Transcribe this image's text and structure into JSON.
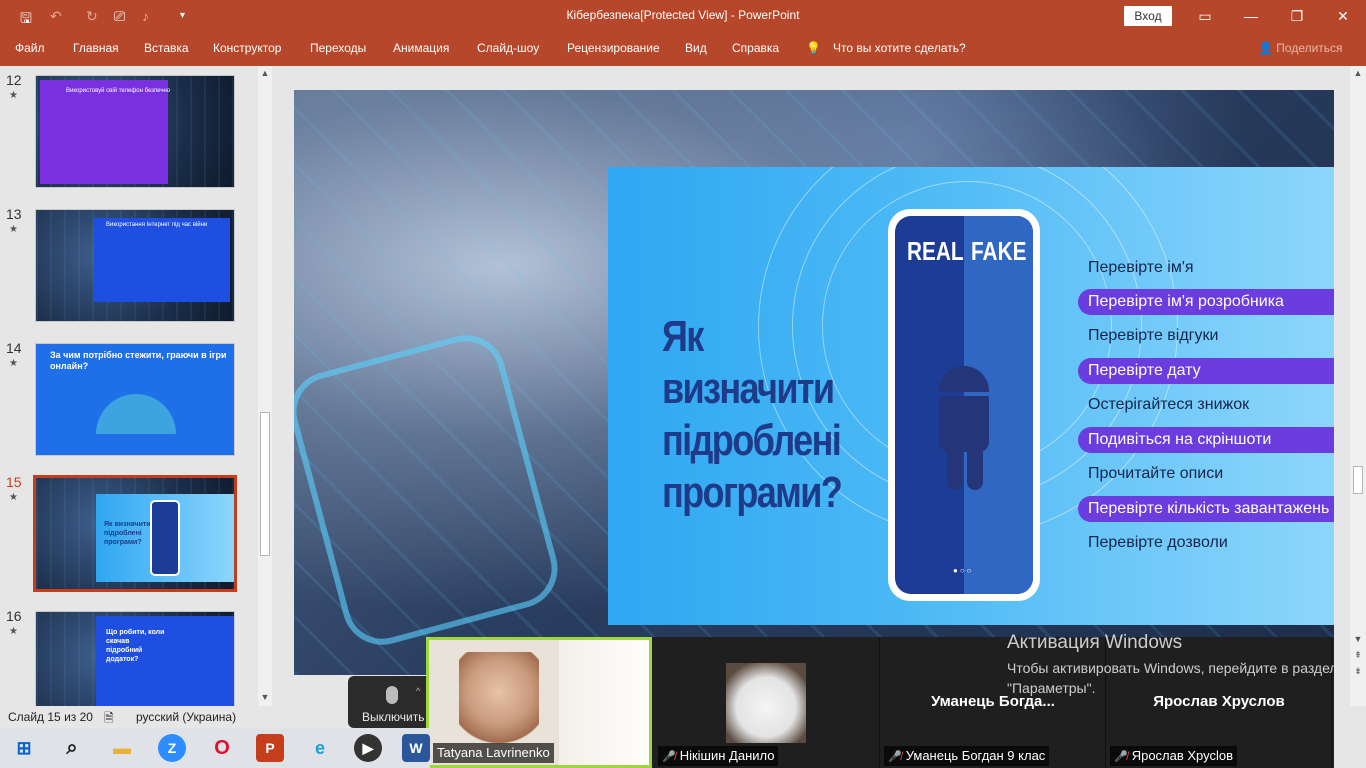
{
  "window": {
    "title": "Кібербезпека[Protected View]  -  PowerPoint",
    "signin": "Вход"
  },
  "ribbon": {
    "tabs": [
      "Файл",
      "Главная",
      "Вставка",
      "Конструктор",
      "Переходы",
      "Анимация",
      "Слайд-шоу",
      "Рецензирование",
      "Вид",
      "Справка"
    ],
    "tell_me": "Что вы хотите сделать?",
    "share": "Поделиться"
  },
  "thumbnails": [
    {
      "num": "12",
      "title": "Використовуй свій телефон безпечно"
    },
    {
      "num": "13",
      "title": "Використання Інтернет під час війни"
    },
    {
      "num": "14",
      "title": "За чим потрібно стежити, граючи в ігри онлайн?"
    },
    {
      "num": "15",
      "title": "Як визначити підроблені програми?"
    },
    {
      "num": "16",
      "title": "Що робити, коли скачав підробний додаток?"
    }
  ],
  "slide": {
    "title": "Як визначити підроблені програми?",
    "phone_left": "REAL",
    "phone_right": "FAKE",
    "tips": [
      {
        "text": "Перевірте ім'я",
        "highlight": false
      },
      {
        "text": "Перевірте ім'я розробника",
        "highlight": true
      },
      {
        "text": "Перевірте відгуки",
        "highlight": false
      },
      {
        "text": "Перевірте дату",
        "highlight": true
      },
      {
        "text": "Остерігайтеся знижок",
        "highlight": false
      },
      {
        "text": "Подивіться на скріншоти",
        "highlight": true
      },
      {
        "text": "Прочитайте описи",
        "highlight": false
      },
      {
        "text": "Перевірте кількість завантажень",
        "highlight": true
      },
      {
        "text": "Перевірте дозволи",
        "highlight": false
      }
    ]
  },
  "status": {
    "slide_counter": "Слайд 15 из 20",
    "language": "русский (Украина)"
  },
  "zoom": {
    "mute_label": "Выключить",
    "participants": [
      {
        "name": "Tatyana Lavrinenko",
        "big_name": "",
        "muted": false
      },
      {
        "name": "Нікішин Данило",
        "big_name": "",
        "muted": true
      },
      {
        "name": "Уманець Богдан 9 клас",
        "big_name": "Уманець  Богда...",
        "muted": true
      },
      {
        "name": "Ярослав Хрусlов",
        "big_name": "Ярослав Хруслов",
        "muted": true
      }
    ]
  },
  "activation": {
    "title": "Активация Windows",
    "text": "Чтобы активировать Windows, перейдите в раздел \"Параметры\"."
  },
  "colors": {
    "ppt_brand": "#b7472a",
    "selected_thumb": "#c43e1c",
    "tip_highlight": "#6b3cde",
    "slide_title": "#1e3b8a"
  }
}
